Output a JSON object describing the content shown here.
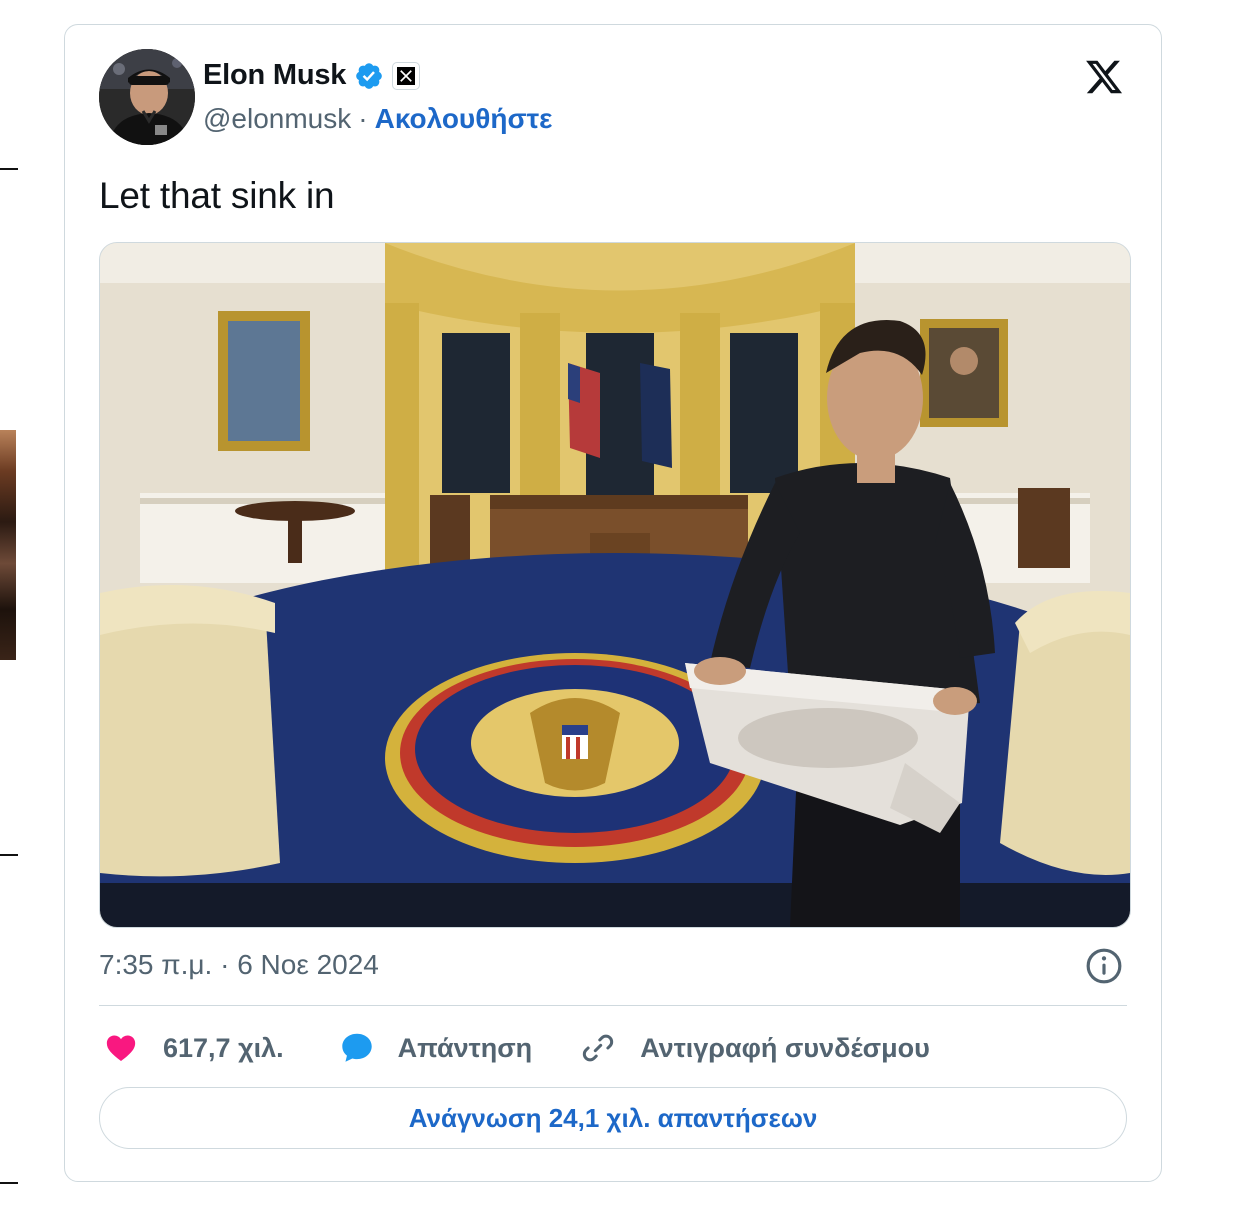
{
  "tweet": {
    "author_name": "Elon Musk",
    "handle": "@elonmusk",
    "separator": "·",
    "follow_label": "Ακολουθήστε",
    "text": "Let that sink in",
    "time": "7:35 π.μ.",
    "date": "6 Νοε 2024",
    "likes": "617,7 χιλ.",
    "reply_label": "Απάντηση",
    "copy_link_label": "Αντιγραφή συνδέσμου",
    "read_replies_label": "Ανάγνωση 24,1 χιλ. απαντήσεων"
  },
  "icons": {
    "verified": "verified-badge",
    "affiliate": "x-affiliate-badge",
    "brand": "x-logo",
    "info": "info-circle",
    "like": "heart",
    "reply": "speech-bubble",
    "copy": "link"
  },
  "colors": {
    "link_blue": "#1d68c8",
    "verified_blue": "#1d9bf0",
    "heart_pink": "#f91880",
    "muted_text": "#536471",
    "border": "#cfd9de"
  }
}
